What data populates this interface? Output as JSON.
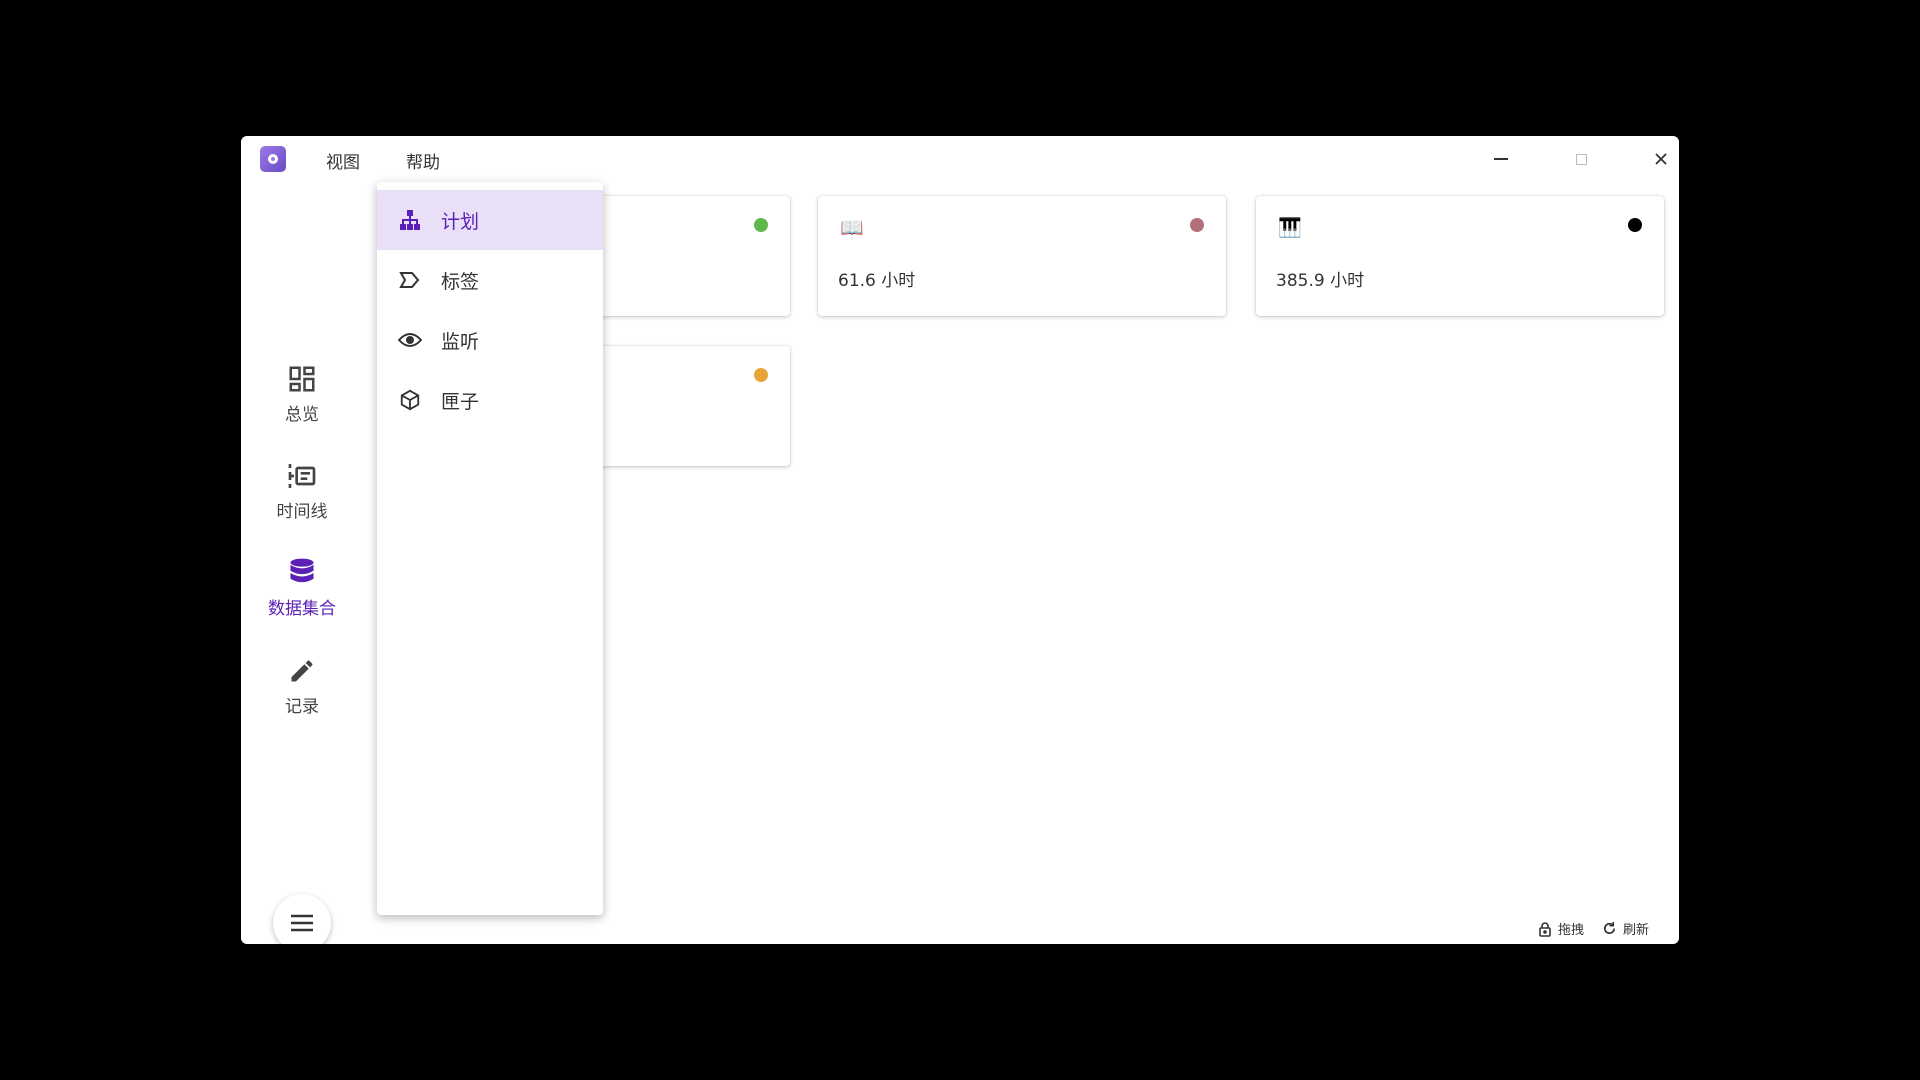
{
  "menu": {
    "view": "视图",
    "help": "帮助"
  },
  "rail": {
    "items": [
      {
        "label": "总览",
        "icon": "dashboard-icon"
      },
      {
        "label": "时间线",
        "icon": "timeline-icon"
      },
      {
        "label": "数据集合",
        "icon": "database-icon",
        "active": true
      },
      {
        "label": "记录",
        "icon": "pencil-icon"
      }
    ],
    "fab_icon": "hamburger-menu-icon"
  },
  "dropdown": {
    "items": [
      {
        "label": "计划",
        "icon": "sitemap-icon",
        "active": true
      },
      {
        "label": "标签",
        "icon": "tag-outline-icon"
      },
      {
        "label": "监听",
        "icon": "eye-icon"
      },
      {
        "label": "匣子",
        "icon": "cube-icon"
      }
    ]
  },
  "cards": [
    {
      "icon": "",
      "value": "",
      "dot_color": "#5eb84a"
    },
    {
      "icon": "📖",
      "value": "61.6 小时",
      "dot_color": "#b3707a"
    },
    {
      "icon": "🎹",
      "value": "385.9 小时",
      "dot_color": "#000000"
    },
    {
      "icon": "",
      "value": "",
      "dot_color": "#e8a336"
    }
  ],
  "footer": {
    "drag_label": "拖拽",
    "refresh_label": "刷新"
  },
  "colors": {
    "accent": "#5b21b6",
    "active_bg": "#e9dff6"
  }
}
